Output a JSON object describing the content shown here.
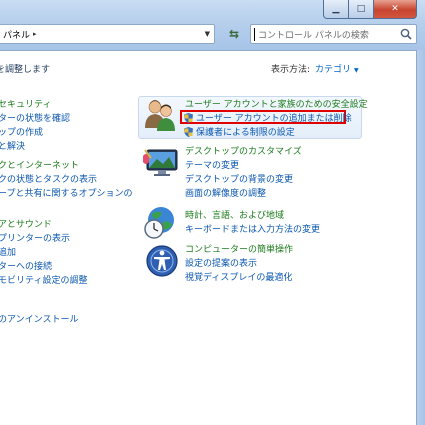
{
  "window": {
    "minimize_icon": "minimize-icon",
    "maximize_icon": "maximize-icon",
    "close_icon": "close-icon"
  },
  "address": {
    "path": "パネル",
    "separator": "▸"
  },
  "search": {
    "placeholder": "コントロール パネルの検索"
  },
  "main": {
    "heading": "を調整します",
    "view_by_label": "表示方法:",
    "view_by_value": "カテゴリ"
  },
  "left_categories": [
    {
      "title": "セキュリティ",
      "links": [
        "ターの状態を確認",
        "ップの作成",
        "と解決"
      ]
    },
    {
      "title": "クとインターネット",
      "links": [
        "クの状態とタスクの表示",
        "ープと共有に関するオプションの"
      ]
    },
    {
      "title": "アとサウンド",
      "links": [
        "プリンターの表示",
        "追加",
        "ターへの接続",
        "モビリティ設定の調整"
      ]
    },
    {
      "title": "",
      "links": [
        "のアンインストール"
      ]
    }
  ],
  "right_categories": [
    {
      "title": "ユーザー アカウントと家族のための安全設定",
      "links": [
        "ユーザー アカウントの追加または削除",
        "保護者による制限の設定"
      ]
    },
    {
      "title": "デスクトップのカスタマイズ",
      "links": [
        "テーマの変更",
        "デスクトップの背景の変更",
        "画面の解像度の調整"
      ]
    },
    {
      "title": "時計、言語、および地域",
      "links": [
        "キーボードまたは入力方法の変更"
      ]
    },
    {
      "title": "コンピューターの簡単操作",
      "links": [
        "設定の提案の表示",
        "視覚ディスプレイの最適化"
      ]
    }
  ],
  "colors": {
    "category_title": "#1b7b1b",
    "link": "#0b57b0",
    "highlight_border": "#e00000"
  }
}
